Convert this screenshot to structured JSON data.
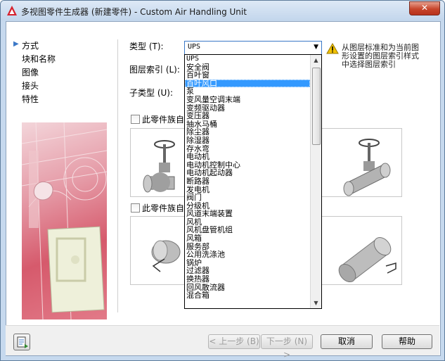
{
  "window": {
    "title": "多视图零件生成器 (新建零件) - Custom Air Handling Unit",
    "close_label": "✕"
  },
  "nav": {
    "items": [
      {
        "label": "方式",
        "active": true
      },
      {
        "label": "块和名称"
      },
      {
        "label": "图像"
      },
      {
        "label": "接头"
      },
      {
        "label": "特性"
      }
    ]
  },
  "form": {
    "type_label": "类型 (T):",
    "layer_label": "图层索引 (L):",
    "subtype_label": "子类型 (U):",
    "type_value": "UPS",
    "warning_text": "从图层标准和为当前图形设置的图层索引样式中选择图层索引"
  },
  "dropdown": {
    "options": [
      "UPS",
      "安全阀",
      "百叶窗",
      "百叶风口",
      "泵",
      "变风量空调末端",
      "变频驱动器",
      "变压器",
      "抽水马桶",
      "除尘器",
      "除湿器",
      "存水弯",
      "电动机",
      "电动机控制中心",
      "电动机起动器",
      "断路器",
      "发电机",
      "阀门",
      "分级机",
      "风道末端装置",
      "风机",
      "风机盘管机组",
      "风箱",
      "服务部",
      "公用洗涤池",
      "锅炉",
      "过滤器",
      "换热器",
      "回风散流器",
      "混合箱"
    ],
    "selected_index": 3
  },
  "sections": {
    "checkbox1_label": "此零件族自",
    "checkbox2_label": "此零件族自"
  },
  "buttons": {
    "prev": "< 上一步 (B)",
    "next": "下一步 (N) >",
    "cancel": "取消",
    "help": "帮助"
  },
  "colors": {
    "accent": "#3399ff",
    "title_bg": "#c6d9ee",
    "warning": "#f2c200"
  }
}
